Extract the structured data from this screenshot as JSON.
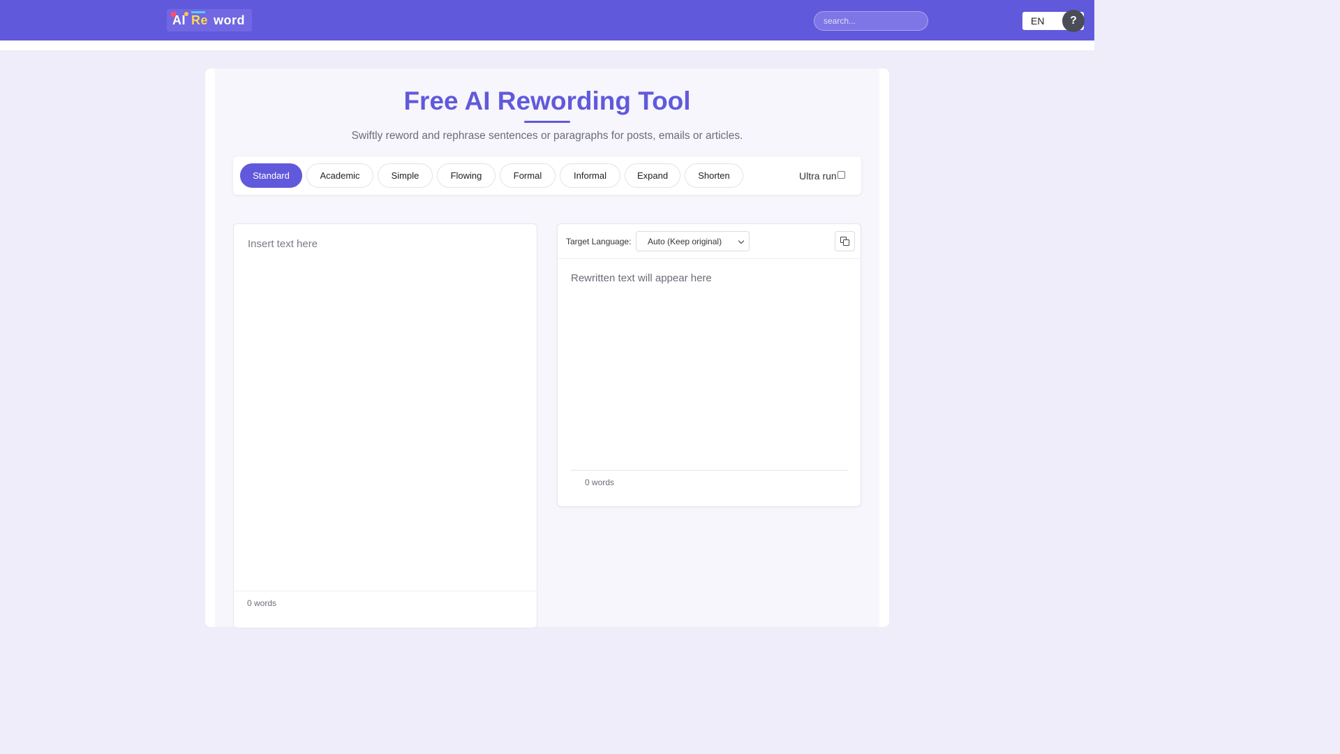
{
  "header": {
    "logo": {
      "part1": "AI",
      "part2": "Re",
      "part3": "word"
    },
    "search_placeholder": "search...",
    "language": "EN",
    "help_label": "?"
  },
  "main": {
    "title": "Free AI Rewording Tool",
    "subtitle": "Swiftly reword and rephrase sentences or paragraphs for posts, emails or articles.",
    "modes": [
      {
        "label": "Standard",
        "active": true
      },
      {
        "label": "Academic",
        "active": false
      },
      {
        "label": "Simple",
        "active": false
      },
      {
        "label": "Flowing",
        "active": false
      },
      {
        "label": "Formal",
        "active": false
      },
      {
        "label": "Informal",
        "active": false
      },
      {
        "label": "Expand",
        "active": false
      },
      {
        "label": "Shorten",
        "active": false
      }
    ],
    "ultra_run_label": "Ultra run",
    "ultra_run_checked": false
  },
  "input_panel": {
    "placeholder": "Insert text here",
    "word_count": "0 words"
  },
  "output_panel": {
    "target_language_label": "Target Language:",
    "target_language_value": "Auto (Keep original)",
    "placeholder": "Rewritten text will appear here",
    "word_count": "0 words",
    "copy_icon": "copy-icon"
  },
  "colors": {
    "brand": "#6159db",
    "page_bg": "#eeedf9"
  }
}
